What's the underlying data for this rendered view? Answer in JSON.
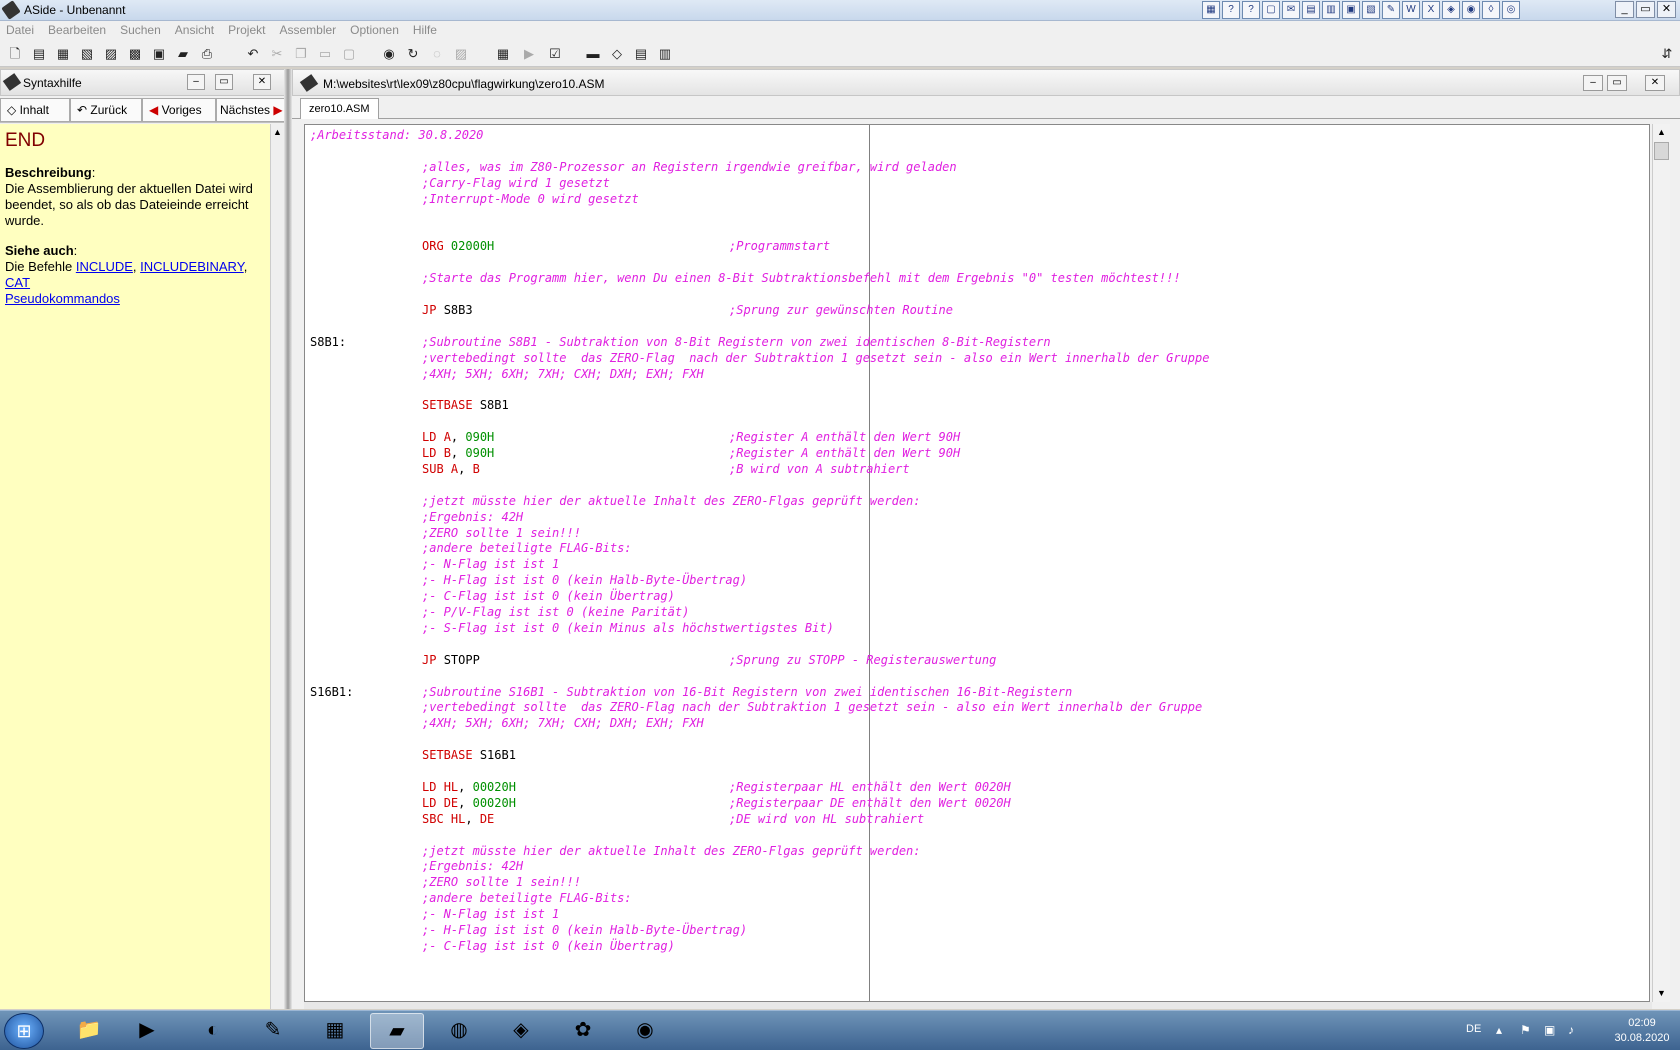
{
  "window": {
    "title": "ASide - Unbenannt"
  },
  "menu": [
    "Datei",
    "Bearbeiten",
    "Suchen",
    "Ansicht",
    "Projekt",
    "Assembler",
    "Optionen",
    "Hilfe"
  ],
  "help_panel": {
    "title": "Syntaxhilfe",
    "nav": {
      "contents": "Inhalt",
      "back": "Zurück",
      "previous": "Voriges",
      "next": "Nächstes"
    },
    "keyword": "END",
    "description_heading": "Beschreibung",
    "description": "Die Assemblierung der aktuellen Datei wird beendet, so als ob das Dateieinde erreicht wurde.",
    "see_also_heading": "Siehe auch",
    "see_also_prefix": "Die Befehle ",
    "links": [
      "INCLUDE",
      "INCLUDEBINARY",
      "CAT",
      "Pseudokommandos"
    ]
  },
  "editor": {
    "path": "M:\\websites\\rt\\lex09\\z80cpu\\flagwirkung\\zero10.ASM",
    "tab": "zero10.ASM",
    "lines": [
      {
        "type": "c0",
        "text": ";Arbeitsstand: 30.8.2020"
      },
      {
        "type": "blank"
      },
      {
        "type": "c",
        "text": ";alles, was im Z80-Prozessor an Registern irgendwie greifbar, wird geladen"
      },
      {
        "type": "c",
        "text": ";Carry-Flag wird 1 gesetzt"
      },
      {
        "type": "c",
        "text": ";Interrupt-Mode 0 wird gesetzt"
      },
      {
        "type": "blank"
      },
      {
        "type": "blank"
      },
      {
        "type": "i",
        "ins": "ORG",
        "arg1": "02000H",
        "cmt": ";Programmstart"
      },
      {
        "type": "blank"
      },
      {
        "type": "c",
        "text": ";Starte das Programm hier, wenn Du einen 8-Bit Subtraktionsbefehl mit dem Ergebnis \"0\" testen möchtest!!!"
      },
      {
        "type": "blank"
      },
      {
        "type": "j",
        "ins": "JP",
        "arg": "S8B3",
        "cmt": ";Sprung zur gewünschten Routine"
      },
      {
        "type": "blank"
      },
      {
        "type": "c",
        "label": "S8B1:",
        "text": ";Subroutine S8B1 - Subtraktion von 8-Bit Registern von zwei identischen 8-Bit-Registern"
      },
      {
        "type": "c",
        "text": ";vertebedingt sollte  das ZERO-Flag  nach der Subtraktion 1 gesetzt sein - also ein Wert innerhalb der Gruppe"
      },
      {
        "type": "c",
        "text": ";4XH; 5XH; 6XH; 7XH; CXH; DXH; EXH; FXH"
      },
      {
        "type": "blank"
      },
      {
        "type": "s",
        "ins": "SETBASE",
        "arg": "S8B1"
      },
      {
        "type": "blank"
      },
      {
        "type": "i",
        "ins": "LD",
        "reg": "A",
        "sep": ", ",
        "arg1": "090H",
        "cmt": ";Register A enthält den Wert 90H"
      },
      {
        "type": "i",
        "ins": "LD",
        "reg": "B",
        "sep": ", ",
        "arg1": "090H",
        "cmt": ";Register A enthält den Wert 90H"
      },
      {
        "type": "r",
        "ins": "SUB",
        "reg": "A",
        "reg2": "B",
        "cmt": ";B wird von A subtrahiert"
      },
      {
        "type": "blank"
      },
      {
        "type": "c",
        "text": ";jetzt müsste hier der aktuelle Inhalt des ZERO-Flgas geprüft werden:"
      },
      {
        "type": "c",
        "text": ";Ergebnis: 42H"
      },
      {
        "type": "c",
        "text": ";ZERO sollte 1 sein!!!"
      },
      {
        "type": "c",
        "text": ";andere beteiligte FLAG-Bits:"
      },
      {
        "type": "c",
        "text": ";- N-Flag ist ist 1"
      },
      {
        "type": "c",
        "text": ";- H-Flag ist ist 0 (kein Halb-Byte-Übertrag)"
      },
      {
        "type": "c",
        "text": ";- C-Flag ist ist 0 (kein Übertrag)"
      },
      {
        "type": "c",
        "text": ";- P/V-Flag ist ist 0 (keine Parität)"
      },
      {
        "type": "c",
        "text": ";- S-Flag ist ist 0 (kein Minus als höchstwertigstes Bit)"
      },
      {
        "type": "blank"
      },
      {
        "type": "j",
        "ins": "JP",
        "arg": "STOPP",
        "cmt": ";Sprung zu STOPP - Registerauswertung"
      },
      {
        "type": "blank"
      },
      {
        "type": "c",
        "label": "S16B1:",
        "text": ";Subroutine S16B1 - Subtraktion von 16-Bit Registern von zwei identischen 16-Bit-Registern"
      },
      {
        "type": "c",
        "text": ";vertebedingt sollte  das ZERO-Flag nach der Subtraktion 1 gesetzt sein - also ein Wert innerhalb der Gruppe"
      },
      {
        "type": "c",
        "text": ";4XH; 5XH; 6XH; 7XH; CXH; DXH; EXH; FXH"
      },
      {
        "type": "blank"
      },
      {
        "type": "s",
        "ins": "SETBASE",
        "arg": "S16B1"
      },
      {
        "type": "blank"
      },
      {
        "type": "i",
        "ins": "LD",
        "reg": "HL",
        "sep": ", ",
        "arg1": "00020H",
        "cmt": ";Registerpaar HL enthält den Wert 0020H"
      },
      {
        "type": "i",
        "ins": "LD",
        "reg": "DE",
        "sep": ", ",
        "arg1": "00020H",
        "cmt": ";Registerpaar DE enthält den Wert 0020H"
      },
      {
        "type": "r",
        "ins": "SBC",
        "reg": "HL",
        "reg2": "DE",
        "cmt": ";DE wird von HL subtrahiert"
      },
      {
        "type": "blank"
      },
      {
        "type": "c",
        "text": ";jetzt müsste hier der aktuelle Inhalt des ZERO-Flgas geprüft werden:"
      },
      {
        "type": "c",
        "text": ";Ergebnis: 42H"
      },
      {
        "type": "c",
        "text": ";ZERO sollte 1 sein!!!"
      },
      {
        "type": "c",
        "text": ";andere beteiligte FLAG-Bits:"
      },
      {
        "type": "c",
        "text": ";- N-Flag ist ist 1"
      },
      {
        "type": "c",
        "text": ";- H-Flag ist ist 0 (kein Halb-Byte-Übertrag)"
      },
      {
        "type": "c",
        "text": ";- C-Flag ist ist 0 (kein Übertrag)"
      }
    ]
  },
  "taskbar": {
    "language": "DE",
    "time": "02:09",
    "date": "30.08.2020"
  },
  "colors": {
    "comment": "#e020e0",
    "instruction": "#d00000",
    "number": "#009000",
    "help_bg": "#ffffc0",
    "keyword": "#800000"
  }
}
